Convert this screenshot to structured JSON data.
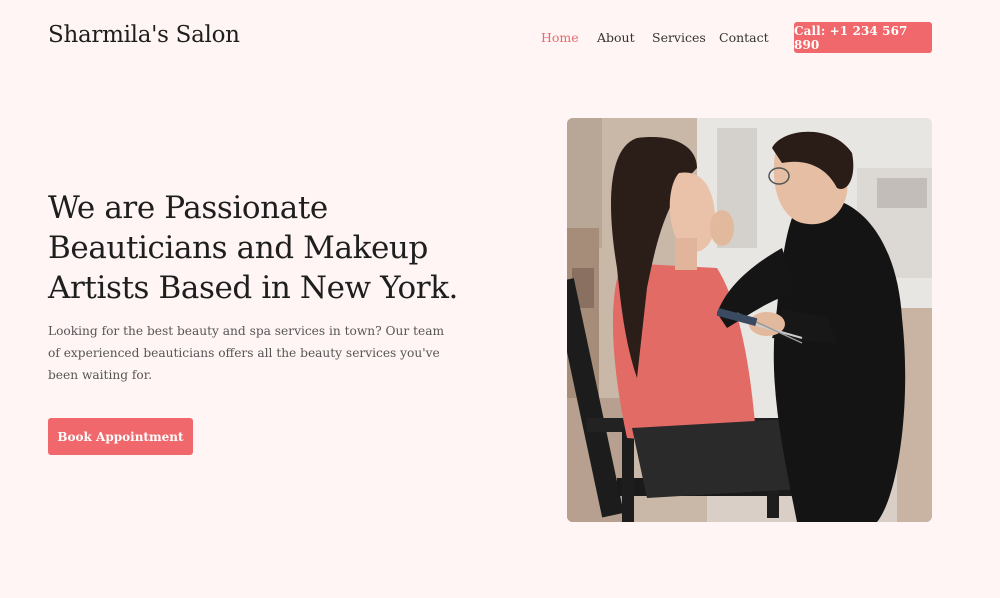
{
  "header": {
    "logo": "Sharmila's Salon",
    "nav": [
      {
        "label": "Home",
        "active": true
      },
      {
        "label": "About",
        "active": false
      },
      {
        "label": "Services",
        "active": false
      },
      {
        "label": "Contact",
        "active": false
      }
    ],
    "call_button": "Call: +1 234 567 890"
  },
  "hero": {
    "title": "We are Passionate Beauticians and Makeup Artists Based in New York.",
    "description": "Looking for the best beauty and spa services in town? Our team of experienced beauticians offers all the beauty services you've been waiting for.",
    "cta": "Book Appointment",
    "image_icon": "makeup-artist-photo"
  },
  "colors": {
    "background": "#fff5f4",
    "accent": "#f0686b",
    "active_nav": "#e86a6e",
    "text": "#1e1e1e"
  }
}
